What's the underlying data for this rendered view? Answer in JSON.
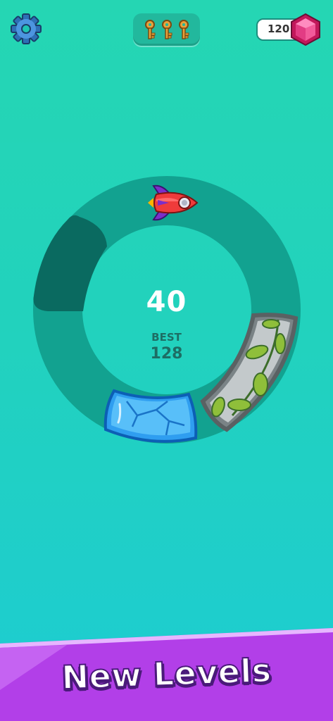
{
  "header": {
    "settings_icon": "gear-icon",
    "keys_icon": "key-icon",
    "keys_count": 3,
    "gems": "120",
    "gem_icon": "pink-gem-icon"
  },
  "game": {
    "score": "40",
    "best_label": "BEST",
    "best_value": "128",
    "player_icon": "rocket-icon",
    "obstacles": [
      "ice-block",
      "stone-vine-block"
    ]
  },
  "banner": {
    "text": "New Levels"
  },
  "colors": {
    "background": "#22d2bd",
    "ring": "#13a594",
    "shadow_segment": "#0a6a60",
    "banner": "#b23fe8",
    "banner_text_outline": "#4a1a7a"
  }
}
